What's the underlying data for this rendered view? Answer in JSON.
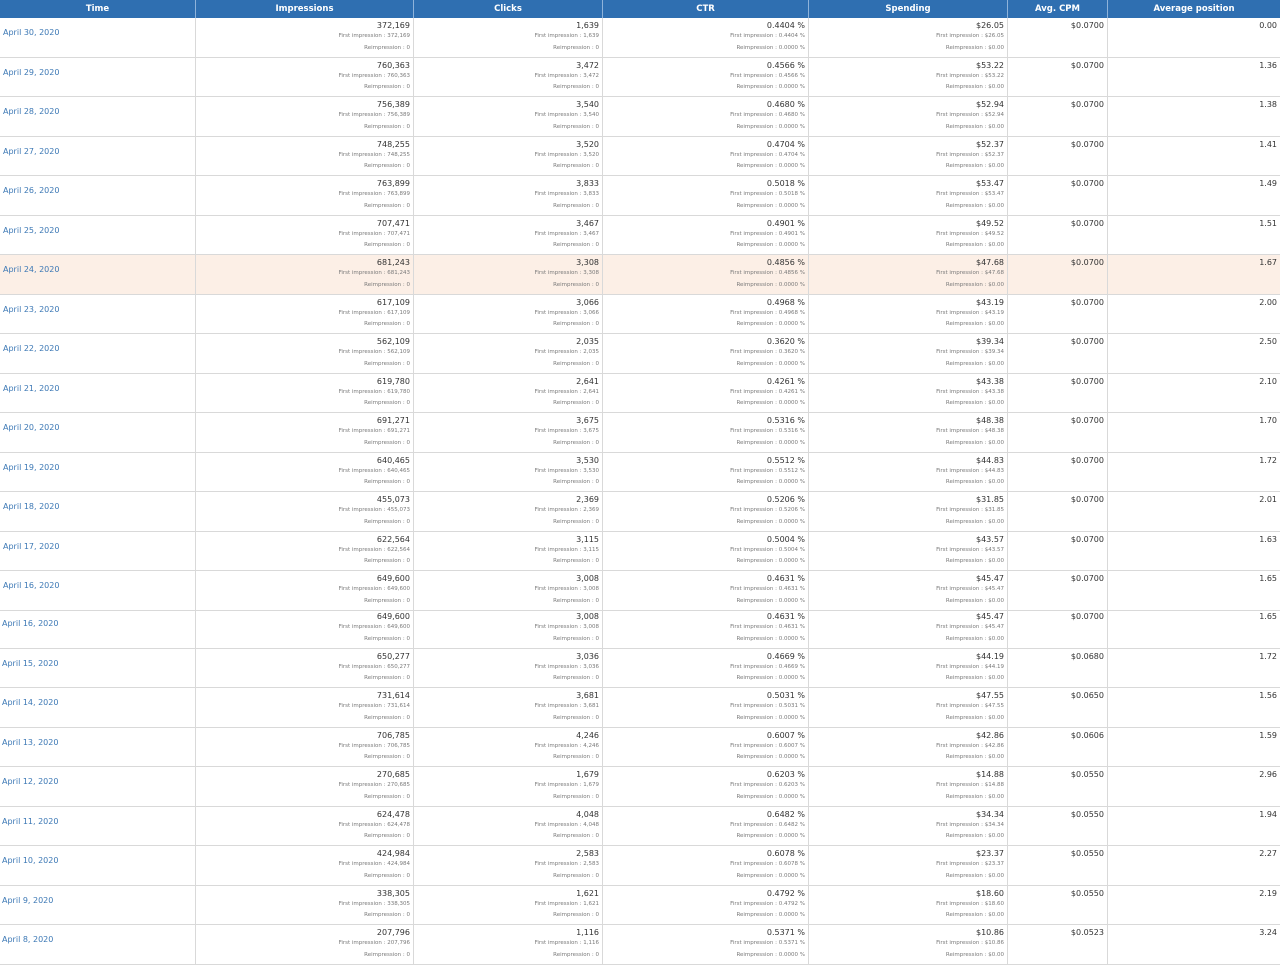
{
  "columns": [
    "Time",
    "Impressions",
    "Clicks",
    "CTR",
    "Spending",
    "Avg. CPM",
    "Average position"
  ],
  "first_label": "First impression : ",
  "re_label": "Reimpression : ",
  "rows_a": [
    {
      "date": "April 30, 2020",
      "impressions": "372,169",
      "impr_first": "372,169",
      "impr_re": "0",
      "clicks": "1,639",
      "clicks_first": "1,639",
      "clicks_re": "0",
      "ctr": "0.4404 %",
      "ctr_first": "0.4404 %",
      "ctr_re": "0.0000 %",
      "spending": "$26.05",
      "spend_first": "$26.05",
      "spend_re": "$0.00",
      "cpm": "$0.0700",
      "position": "0.00"
    },
    {
      "date": "April 29, 2020",
      "impressions": "760,363",
      "impr_first": "760,363",
      "impr_re": "0",
      "clicks": "3,472",
      "clicks_first": "3,472",
      "clicks_re": "0",
      "ctr": "0.4566 %",
      "ctr_first": "0.4566 %",
      "ctr_re": "0.0000 %",
      "spending": "$53.22",
      "spend_first": "$53.22",
      "spend_re": "$0.00",
      "cpm": "$0.0700",
      "position": "1.36"
    },
    {
      "date": "April 28, 2020",
      "impressions": "756,389",
      "impr_first": "756,389",
      "impr_re": "0",
      "clicks": "3,540",
      "clicks_first": "3,540",
      "clicks_re": "0",
      "ctr": "0.4680 %",
      "ctr_first": "0.4680 %",
      "ctr_re": "0.0000 %",
      "spending": "$52.94",
      "spend_first": "$52.94",
      "spend_re": "$0.00",
      "cpm": "$0.0700",
      "position": "1.38"
    },
    {
      "date": "April 27, 2020",
      "impressions": "748,255",
      "impr_first": "748,255",
      "impr_re": "0",
      "clicks": "3,520",
      "clicks_first": "3,520",
      "clicks_re": "0",
      "ctr": "0.4704 %",
      "ctr_first": "0.4704 %",
      "ctr_re": "0.0000 %",
      "spending": "$52.37",
      "spend_first": "$52.37",
      "spend_re": "$0.00",
      "cpm": "$0.0700",
      "position": "1.41"
    },
    {
      "date": "April 26, 2020",
      "impressions": "763,899",
      "impr_first": "763,899",
      "impr_re": "0",
      "clicks": "3,833",
      "clicks_first": "3,833",
      "clicks_re": "0",
      "ctr": "0.5018 %",
      "ctr_first": "0.5018 %",
      "ctr_re": "0.0000 %",
      "spending": "$53.47",
      "spend_first": "$53.47",
      "spend_re": "$0.00",
      "cpm": "$0.0700",
      "position": "1.49"
    },
    {
      "date": "April 25, 2020",
      "impressions": "707,471",
      "impr_first": "707,471",
      "impr_re": "0",
      "clicks": "3,467",
      "clicks_first": "3,467",
      "clicks_re": "0",
      "ctr": "0.4901 %",
      "ctr_first": "0.4901 %",
      "ctr_re": "0.0000 %",
      "spending": "$49.52",
      "spend_first": "$49.52",
      "spend_re": "$0.00",
      "cpm": "$0.0700",
      "position": "1.51"
    },
    {
      "date": "April 24, 2020",
      "impressions": "681,243",
      "impr_first": "681,243",
      "impr_re": "0",
      "clicks": "3,308",
      "clicks_first": "3,308",
      "clicks_re": "0",
      "ctr": "0.4856 %",
      "ctr_first": "0.4856 %",
      "ctr_re": "0.0000 %",
      "spending": "$47.68",
      "spend_first": "$47.68",
      "spend_re": "$0.00",
      "cpm": "$0.0700",
      "position": "1.67"
    },
    {
      "date": "April 23, 2020",
      "impressions": "617,109",
      "impr_first": "617,109",
      "impr_re": "0",
      "clicks": "3,066",
      "clicks_first": "3,066",
      "clicks_re": "0",
      "ctr": "0.4968 %",
      "ctr_first": "0.4968 %",
      "ctr_re": "0.0000 %",
      "spending": "$43.19",
      "spend_first": "$43.19",
      "spend_re": "$0.00",
      "cpm": "$0.0700",
      "position": "2.00"
    },
    {
      "date": "April 22, 2020",
      "impressions": "562,109",
      "impr_first": "562,109",
      "impr_re": "0",
      "clicks": "2,035",
      "clicks_first": "2,035",
      "clicks_re": "0",
      "ctr": "0.3620 %",
      "ctr_first": "0.3620 %",
      "ctr_re": "0.0000 %",
      "spending": "$39.34",
      "spend_first": "$39.34",
      "spend_re": "$0.00",
      "cpm": "$0.0700",
      "position": "2.50"
    },
    {
      "date": "April 21, 2020",
      "impressions": "619,780",
      "impr_first": "619,780",
      "impr_re": "0",
      "clicks": "2,641",
      "clicks_first": "2,641",
      "clicks_re": "0",
      "ctr": "0.4261 %",
      "ctr_first": "0.4261 %",
      "ctr_re": "0.0000 %",
      "spending": "$43.38",
      "spend_first": "$43.38",
      "spend_re": "$0.00",
      "cpm": "$0.0700",
      "position": "2.10"
    },
    {
      "date": "April 20, 2020",
      "impressions": "691,271",
      "impr_first": "691,271",
      "impr_re": "0",
      "clicks": "3,675",
      "clicks_first": "3,675",
      "clicks_re": "0",
      "ctr": "0.5316 %",
      "ctr_first": "0.5316 %",
      "ctr_re": "0.0000 %",
      "spending": "$48.38",
      "spend_first": "$48.38",
      "spend_re": "$0.00",
      "cpm": "$0.0700",
      "position": "1.70"
    },
    {
      "date": "April 19, 2020",
      "impressions": "640,465",
      "impr_first": "640,465",
      "impr_re": "0",
      "clicks": "3,530",
      "clicks_first": "3,530",
      "clicks_re": "0",
      "ctr": "0.5512 %",
      "ctr_first": "0.5512 %",
      "ctr_re": "0.0000 %",
      "spending": "$44.83",
      "spend_first": "$44.83",
      "spend_re": "$0.00",
      "cpm": "$0.0700",
      "position": "1.72"
    },
    {
      "date": "April 18, 2020",
      "impressions": "455,073",
      "impr_first": "455,073",
      "impr_re": "0",
      "clicks": "2,369",
      "clicks_first": "2,369",
      "clicks_re": "0",
      "ctr": "0.5206 %",
      "ctr_first": "0.5206 %",
      "ctr_re": "0.0000 %",
      "spending": "$31.85",
      "spend_first": "$31.85",
      "spend_re": "$0.00",
      "cpm": "$0.0700",
      "position": "2.01"
    },
    {
      "date": "April 17, 2020",
      "impressions": "622,564",
      "impr_first": "622,564",
      "impr_re": "0",
      "clicks": "3,115",
      "clicks_first": "3,115",
      "clicks_re": "0",
      "ctr": "0.5004 %",
      "ctr_first": "0.5004 %",
      "ctr_re": "0.0000 %",
      "spending": "$43.57",
      "spend_first": "$43.57",
      "spend_re": "$0.00",
      "cpm": "$0.0700",
      "position": "1.63"
    },
    {
      "date": "April 16, 2020",
      "impressions": "649,600",
      "impr_first": "649,600",
      "impr_re": "0",
      "clicks": "3,008",
      "clicks_first": "3,008",
      "clicks_re": "0",
      "ctr": "0.4631 %",
      "ctr_first": "0.4631 %",
      "ctr_re": "0.0000 %",
      "spending": "$45.47",
      "spend_first": "$45.47",
      "spend_re": "$0.00",
      "cpm": "$0.0700",
      "position": "1.65"
    }
  ],
  "rows_b": [
    {
      "date": "April 16, 2020",
      "impressions": "649,600",
      "impr_first": "649,600",
      "impr_re": "0",
      "clicks": "3,008",
      "clicks_first": "3,008",
      "clicks_re": "0",
      "ctr": "0.4631 %",
      "ctr_first": "0.4631 %",
      "ctr_re": "0.0000 %",
      "spending": "$45.47",
      "spend_first": "$45.47",
      "spend_re": "$0.00",
      "cpm": "$0.0700",
      "position": "1.65"
    },
    {
      "date": "April 15, 2020",
      "impressions": "650,277",
      "impr_first": "650,277",
      "impr_re": "0",
      "clicks": "3,036",
      "clicks_first": "3,036",
      "clicks_re": "0",
      "ctr": "0.4669 %",
      "ctr_first": "0.4669 %",
      "ctr_re": "0.0000 %",
      "spending": "$44.19",
      "spend_first": "$44.19",
      "spend_re": "$0.00",
      "cpm": "$0.0680",
      "position": "1.72"
    },
    {
      "date": "April 14, 2020",
      "impressions": "731,614",
      "impr_first": "731,614",
      "impr_re": "0",
      "clicks": "3,681",
      "clicks_first": "3,681",
      "clicks_re": "0",
      "ctr": "0.5031 %",
      "ctr_first": "0.5031 %",
      "ctr_re": "0.0000 %",
      "spending": "$47.55",
      "spend_first": "$47.55",
      "spend_re": "$0.00",
      "cpm": "$0.0650",
      "position": "1.56"
    },
    {
      "date": "April 13, 2020",
      "impressions": "706,785",
      "impr_first": "706,785",
      "impr_re": "0",
      "clicks": "4,246",
      "clicks_first": "4,246",
      "clicks_re": "0",
      "ctr": "0.6007 %",
      "ctr_first": "0.6007 %",
      "ctr_re": "0.0000 %",
      "spending": "$42.86",
      "spend_first": "$42.86",
      "spend_re": "$0.00",
      "cpm": "$0.0606",
      "position": "1.59"
    },
    {
      "date": "April 12, 2020",
      "impressions": "270,685",
      "impr_first": "270,685",
      "impr_re": "0",
      "clicks": "1,679",
      "clicks_first": "1,679",
      "clicks_re": "0",
      "ctr": "0.6203 %",
      "ctr_first": "0.6203 %",
      "ctr_re": "0.0000 %",
      "spending": "$14.88",
      "spend_first": "$14.88",
      "spend_re": "$0.00",
      "cpm": "$0.0550",
      "position": "2.96"
    },
    {
      "date": "April 11, 2020",
      "impressions": "624,478",
      "impr_first": "624,478",
      "impr_re": "0",
      "clicks": "4,048",
      "clicks_first": "4,048",
      "clicks_re": "0",
      "ctr": "0.6482 %",
      "ctr_first": "0.6482 %",
      "ctr_re": "0.0000 %",
      "spending": "$34.34",
      "spend_first": "$34.34",
      "spend_re": "$0.00",
      "cpm": "$0.0550",
      "position": "1.94"
    },
    {
      "date": "April 10, 2020",
      "impressions": "424,984",
      "impr_first": "424,984",
      "impr_re": "0",
      "clicks": "2,583",
      "clicks_first": "2,583",
      "clicks_re": "0",
      "ctr": "0.6078 %",
      "ctr_first": "0.6078 %",
      "ctr_re": "0.0000 %",
      "spending": "$23.37",
      "spend_first": "$23.37",
      "spend_re": "$0.00",
      "cpm": "$0.0550",
      "position": "2.27"
    },
    {
      "date": "April 9, 2020",
      "impressions": "338,305",
      "impr_first": "338,305",
      "impr_re": "0",
      "clicks": "1,621",
      "clicks_first": "1,621",
      "clicks_re": "0",
      "ctr": "0.4792 %",
      "ctr_first": "0.4792 %",
      "ctr_re": "0.0000 %",
      "spending": "$18.60",
      "spend_first": "$18.60",
      "spend_re": "$0.00",
      "cpm": "$0.0550",
      "position": "2.19"
    },
    {
      "date": "April 8, 2020",
      "impressions": "207,796",
      "impr_first": "207,796",
      "impr_re": "0",
      "clicks": "1,116",
      "clicks_first": "1,116",
      "clicks_re": "0",
      "ctr": "0.5371 %",
      "ctr_first": "0.5371 %",
      "ctr_re": "0.0000 %",
      "spending": "$10.86",
      "spend_first": "$10.86",
      "spend_re": "$0.00",
      "cpm": "$0.0523",
      "position": "3.24"
    }
  ],
  "colors": {
    "header_bg": "#2f6fb1",
    "link": "#3c78b5",
    "highlight_row": "#fcefe6"
  }
}
